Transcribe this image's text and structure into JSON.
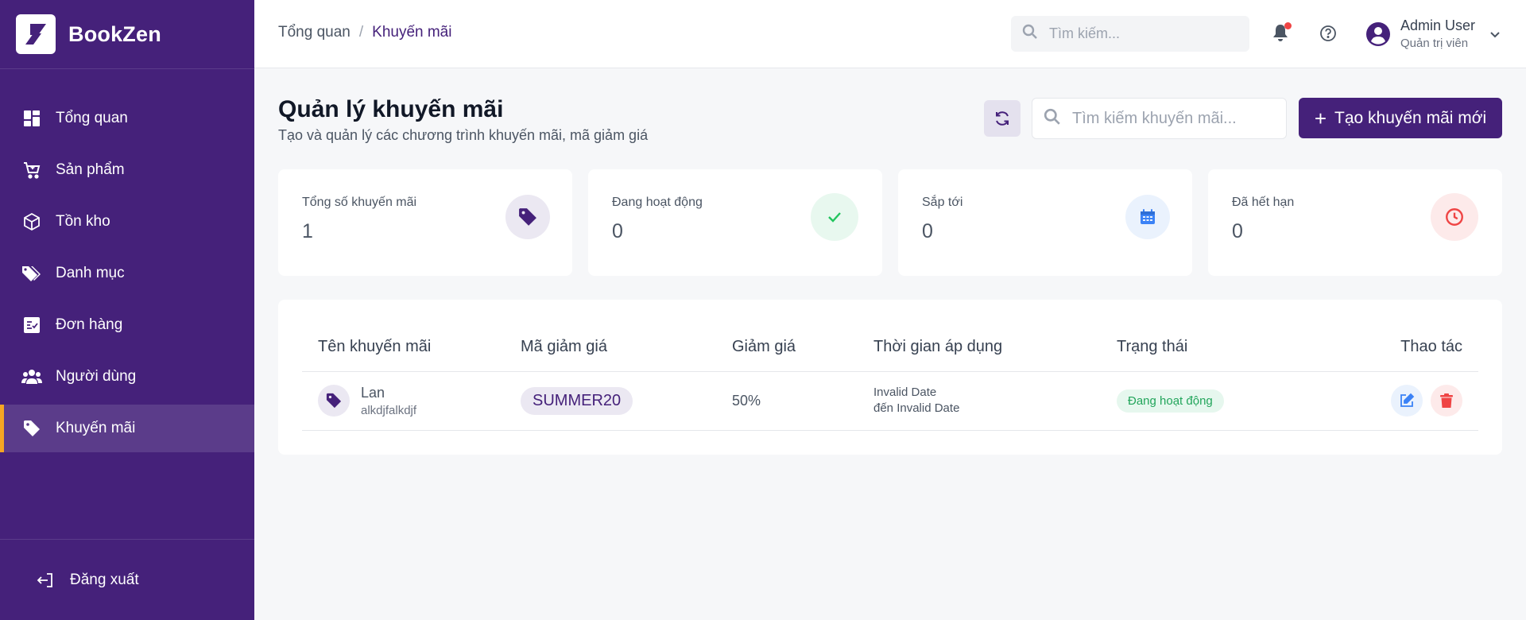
{
  "brand": {
    "name": "BookZen"
  },
  "sidebar": {
    "items": [
      {
        "label": "Tổng quan",
        "icon": "dashboard-icon"
      },
      {
        "label": "Sản phẩm",
        "icon": "cart-icon"
      },
      {
        "label": "Tồn kho",
        "icon": "box-icon"
      },
      {
        "label": "Danh mục",
        "icon": "tags-icon"
      },
      {
        "label": "Đơn hàng",
        "icon": "checklist-icon"
      },
      {
        "label": "Người dùng",
        "icon": "users-icon"
      },
      {
        "label": "Khuyến mãi",
        "icon": "tag-icon",
        "active": true
      }
    ],
    "logout": "Đăng xuất"
  },
  "header": {
    "breadcrumb": [
      "Tổng quan",
      "/",
      "Khuyến mãi"
    ],
    "search_placeholder": "Tìm kiếm...",
    "user": {
      "name": "Admin User",
      "role": "Quản trị viên"
    }
  },
  "page": {
    "title": "Quản lý khuyến mãi",
    "subtitle": "Tạo và quản lý các chương trình khuyến mãi, mã giảm giá",
    "search_placeholder": "Tìm kiếm khuyến mãi...",
    "create_label": "Tạo khuyến mãi mới"
  },
  "stats": [
    {
      "label": "Tổng số khuyến mãi",
      "value": "1",
      "icon": "tag-icon",
      "color": "#45217a",
      "bg": "#ebe8f2"
    },
    {
      "label": "Đang hoạt động",
      "value": "0",
      "icon": "check-icon",
      "color": "#22c55e",
      "bg": "#e8f8ef"
    },
    {
      "label": "Sắp tới",
      "value": "0",
      "icon": "calendar-icon",
      "color": "#3b82f6",
      "bg": "#eaf2fd"
    },
    {
      "label": "Đã hết hạn",
      "value": "0",
      "icon": "clock-icon",
      "color": "#ef4444",
      "bg": "#fdeaea"
    }
  ],
  "table": {
    "columns": [
      "Tên khuyến mãi",
      "Mã giảm giá",
      "Giảm giá",
      "Thời gian áp dụng",
      "Trạng thái",
      "Thao tác"
    ],
    "rows": [
      {
        "name": "Lan",
        "description": "alkdjfalkdjf",
        "code": "SUMMER20",
        "discount": "50%",
        "start": "Invalid Date",
        "end": "đến Invalid Date",
        "status": "Đang hoạt động"
      }
    ]
  },
  "colors": {
    "primary": "#45217a",
    "accent": "#f5a623",
    "success": "#22a55b",
    "danger": "#ef4444",
    "info": "#3b82f6"
  }
}
